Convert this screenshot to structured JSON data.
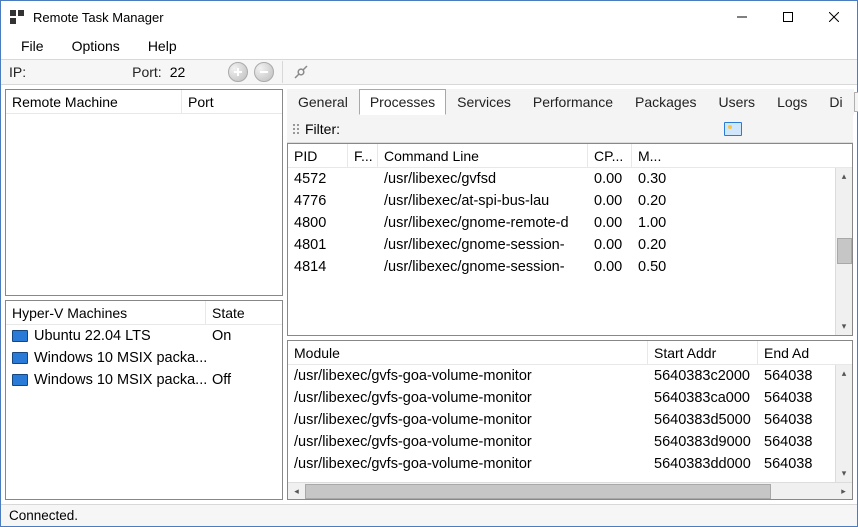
{
  "window": {
    "title": "Remote Task Manager"
  },
  "menu": {
    "file": "File",
    "options": "Options",
    "help": "Help"
  },
  "toolbar": {
    "ip_label": "IP:",
    "ip_value": "",
    "port_label": "Port:",
    "port_value": "22"
  },
  "left": {
    "remote": {
      "cols": {
        "machine": "Remote Machine",
        "port": "Port"
      }
    },
    "hyperv": {
      "cols": {
        "name": "Hyper-V Machines",
        "state": "State"
      },
      "rows": [
        {
          "name": "Ubuntu 22.04 LTS",
          "state": "On"
        },
        {
          "name": "Windows 10 MSIX packa...",
          "state": ""
        },
        {
          "name": "Windows 10 MSIX packa...",
          "state": "Off"
        }
      ]
    }
  },
  "tabs": {
    "items": [
      "General",
      "Processes",
      "Services",
      "Performance",
      "Packages",
      "Users",
      "Logs",
      "Di"
    ],
    "active_index": 1
  },
  "filter": {
    "label": "Filter:",
    "value": ""
  },
  "process_table": {
    "cols": {
      "pid": "PID",
      "f": "F...",
      "cmd": "Command Line",
      "cpu": "CP...",
      "mem": "M..."
    },
    "rows": [
      {
        "pid": "4572",
        "f": "",
        "cmd": "/usr/libexec/gvfsd",
        "cpu": "0.00",
        "mem": "0.30"
      },
      {
        "pid": "4776",
        "f": "",
        "cmd": "/usr/libexec/at-spi-bus-lau",
        "cpu": "0.00",
        "mem": "0.20"
      },
      {
        "pid": "4800",
        "f": "",
        "cmd": "/usr/libexec/gnome-remote-d",
        "cpu": "0.00",
        "mem": "1.00"
      },
      {
        "pid": "4801",
        "f": "",
        "cmd": "/usr/libexec/gnome-session-",
        "cpu": "0.00",
        "mem": "0.20"
      },
      {
        "pid": "4814",
        "f": "",
        "cmd": "/usr/libexec/gnome-session-",
        "cpu": "0.00",
        "mem": "0.50"
      }
    ]
  },
  "modules": {
    "cols": {
      "module": "Module",
      "start": "Start Addr",
      "end": "End Ad"
    },
    "rows": [
      {
        "module": "/usr/libexec/gvfs-goa-volume-monitor",
        "start": "5640383c2000",
        "end": "564038"
      },
      {
        "module": "/usr/libexec/gvfs-goa-volume-monitor",
        "start": "5640383ca000",
        "end": "564038"
      },
      {
        "module": "/usr/libexec/gvfs-goa-volume-monitor",
        "start": "5640383d5000",
        "end": "564038"
      },
      {
        "module": "/usr/libexec/gvfs-goa-volume-monitor",
        "start": "5640383d9000",
        "end": "564038"
      },
      {
        "module": "/usr/libexec/gvfs-goa-volume-monitor",
        "start": "5640383dd000",
        "end": "564038"
      }
    ]
  },
  "status": {
    "text": "Connected."
  }
}
